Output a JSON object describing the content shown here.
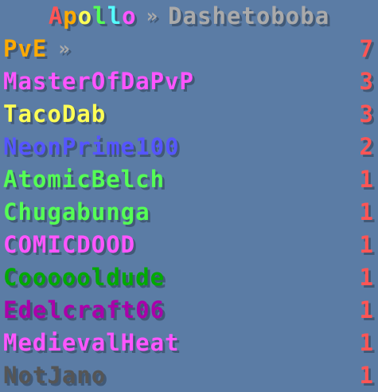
{
  "colors": {
    "background": "#5b7ca5",
    "score": "#ff5555",
    "separator": "#aaaaaa"
  },
  "header": {
    "title_letters": [
      {
        "char": "A",
        "color": "#ff5555"
      },
      {
        "char": "p",
        "color": "#ffaa00"
      },
      {
        "char": "o",
        "color": "#ffff55"
      },
      {
        "char": "l",
        "color": "#55ff55"
      },
      {
        "char": "l",
        "color": "#55ffff"
      },
      {
        "char": "o",
        "color": "#ff55ff"
      }
    ],
    "separator": "»",
    "subtitle": "Dashetoboba",
    "subtitle_color": "#aaaaaa"
  },
  "rows": [
    {
      "name": "PvE",
      "color": "#ffaa00",
      "score": "7",
      "separator": "»"
    },
    {
      "name": "MasterOfDaPvP",
      "color": "#ff55ff",
      "score": "3"
    },
    {
      "name": "TacoDab",
      "color": "#ffff55",
      "score": "3"
    },
    {
      "name": "NeonPrime100",
      "color": "#5555ff",
      "score": "2"
    },
    {
      "name": "AtomicBelch",
      "color": "#55ff55",
      "score": "1"
    },
    {
      "name": "Chugabunga",
      "color": "#55ff55",
      "score": "1"
    },
    {
      "name": "COMICDOOD",
      "color": "#ff55ff",
      "score": "1"
    },
    {
      "name": "Coooooldude",
      "color": "#00aa00",
      "score": "1"
    },
    {
      "name": "Edelcraft06",
      "color": "#aa00aa",
      "score": "1"
    },
    {
      "name": "MedievalHeat",
      "color": "#ff55ff",
      "score": "1"
    },
    {
      "name": "NotJano",
      "color": "#555555",
      "score": "1"
    }
  ]
}
